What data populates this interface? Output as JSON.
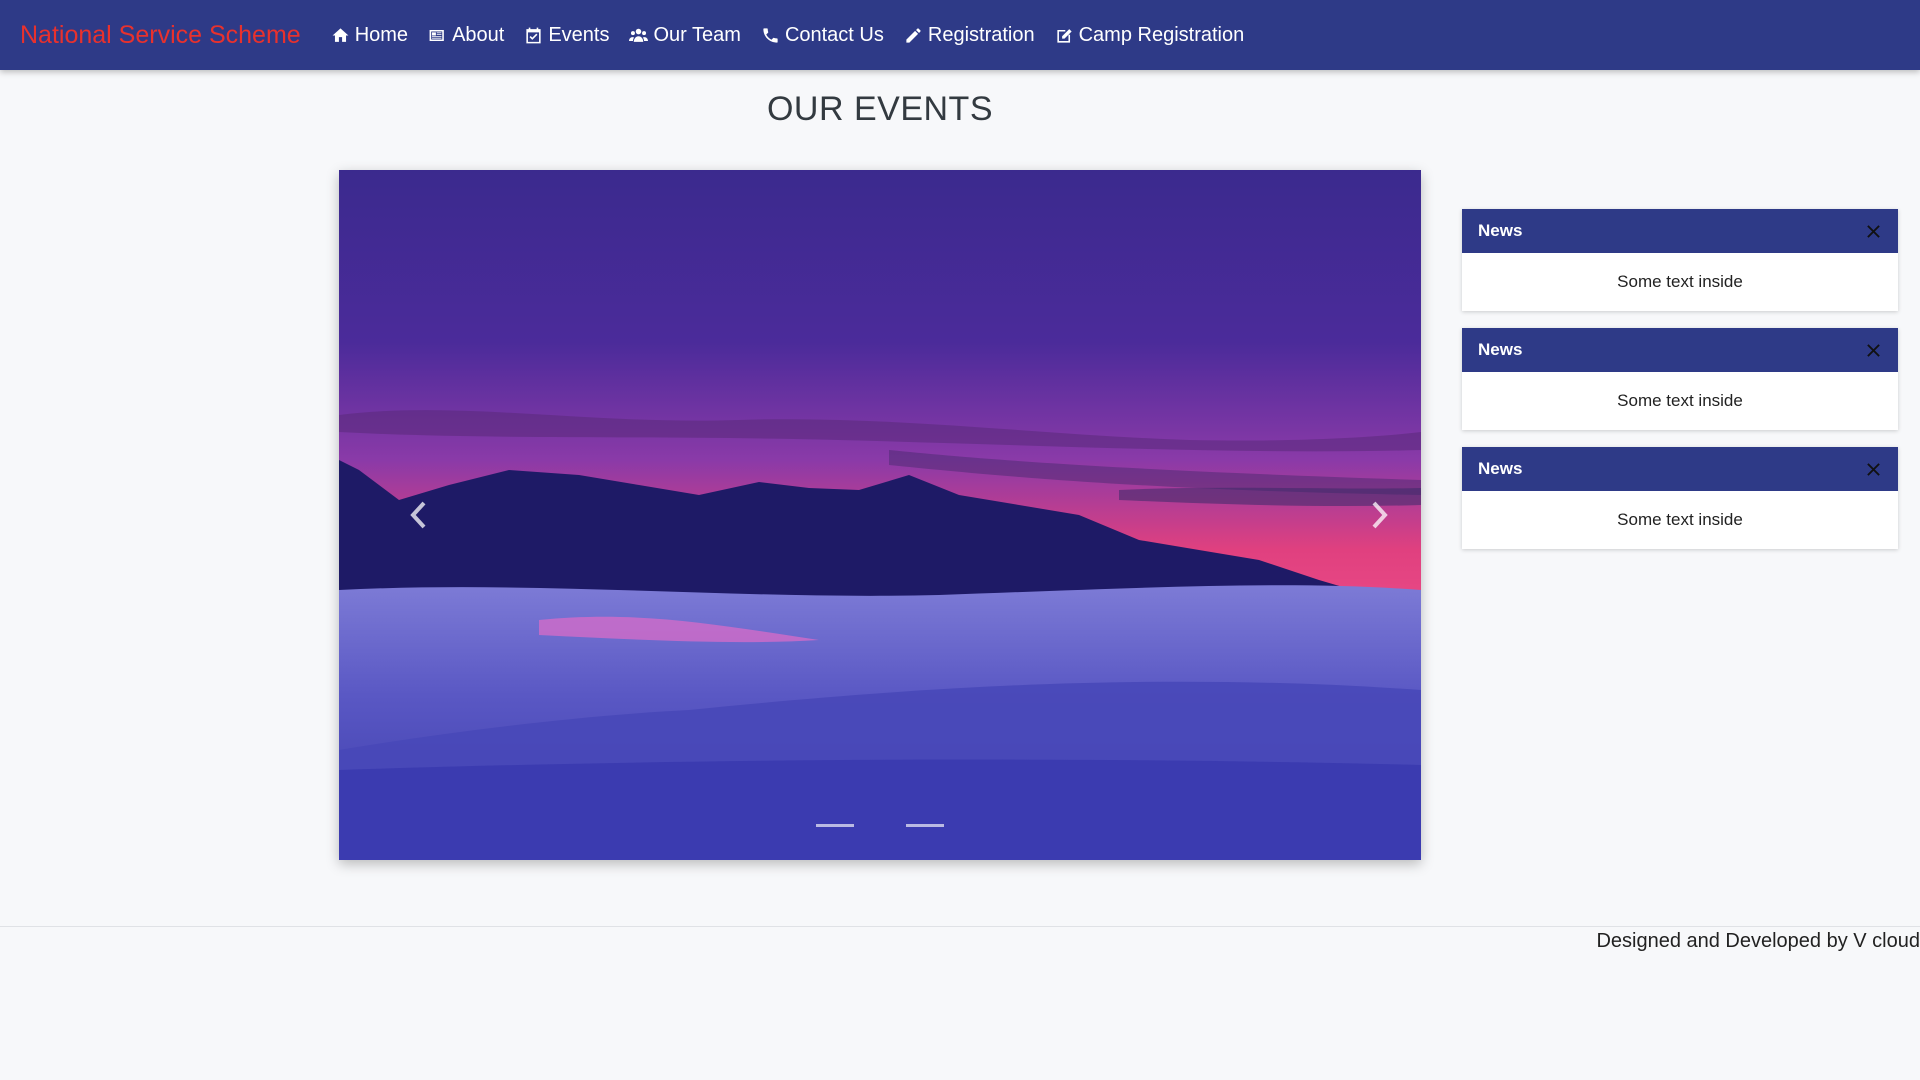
{
  "navbar": {
    "brand": "National Service Scheme",
    "items": [
      {
        "label": "Home",
        "icon": "home-icon"
      },
      {
        "label": "About",
        "icon": "newspaper-icon"
      },
      {
        "label": "Events",
        "icon": "calendar-check-icon"
      },
      {
        "label": "Our Team",
        "icon": "users-icon"
      },
      {
        "label": "Contact Us",
        "icon": "phone-icon"
      },
      {
        "label": "Registration",
        "icon": "pencil-icon"
      },
      {
        "label": "Camp Registration",
        "icon": "edit-icon"
      }
    ]
  },
  "page": {
    "title": "OUR EVENTS"
  },
  "carousel": {
    "slide_count": 2,
    "active_slide": 1,
    "prev_icon": "chevron-left-icon",
    "next_icon": "chevron-right-icon"
  },
  "news": [
    {
      "title": "News",
      "body": "Some text inside"
    },
    {
      "title": "News",
      "body": "Some text inside"
    },
    {
      "title": "News",
      "body": "Some text inside"
    }
  ],
  "footer": {
    "text": "Designed and Developed by V cloud"
  },
  "colors": {
    "navbar": "#2e3a87",
    "brand": "#e8312d",
    "background": "#f7f8fa"
  }
}
